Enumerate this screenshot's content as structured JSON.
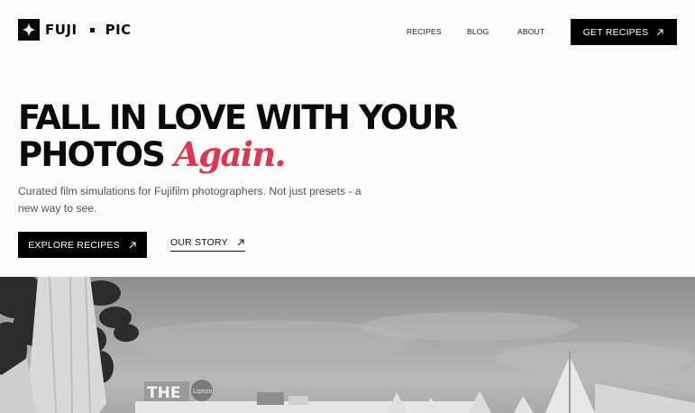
{
  "header": {
    "logo": {
      "word1": "FUJI",
      "word2": "PIC"
    },
    "nav": [
      {
        "label": "RECIPES"
      },
      {
        "label": "BLOG"
      },
      {
        "label": "ABOUT"
      }
    ],
    "cta": {
      "label": "GET RECIPES",
      "icon": "arrow-up-right-icon"
    }
  },
  "hero": {
    "title_line1": "FALL IN LOVE WITH YOUR",
    "title_line2_start": "PHOTOS",
    "title_line2_accent": "Again.",
    "subtitle": "Curated film simulations for Fujifilm photographers. Not just presets - a new way to see.",
    "primary_button": {
      "label": "EXPLORE RECIPES",
      "icon": "arrow-up-right-icon"
    },
    "secondary_link": {
      "label": "OUR STORY",
      "icon": "arrow-up-right-icon"
    }
  },
  "photo": {
    "signs": {
      "the": "THE",
      "lipton": "Lipton"
    }
  },
  "colors": {
    "accent": "#e0344f",
    "primary": "#000000",
    "background": "#fbfbfb"
  }
}
